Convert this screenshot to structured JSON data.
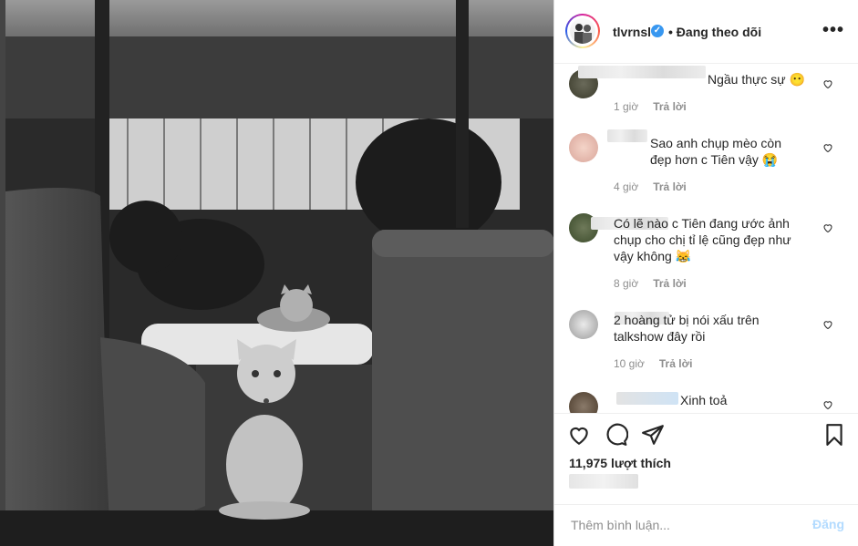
{
  "post": {
    "username": "tlvrnsl",
    "verified_icon": "verified-badge-icon",
    "follow_status": "• Đang theo dõi",
    "more_icon": "•••"
  },
  "comments": [
    {
      "text": "Ngầu thực sự 😶",
      "time": "1 giờ",
      "reply": "Trả lời"
    },
    {
      "text": "Sao anh chụp mèo còn đẹp hơn c Tiên vậy 😭",
      "time": "4 giờ",
      "reply": "Trả lời"
    },
    {
      "text": "Có lẽ nào c Tiên đang ước ảnh chụp cho chị tỉ lệ cũng đẹp như vậy không 😹",
      "time": "8 giờ",
      "reply": "Trả lời"
    },
    {
      "text": "2 hoàng tử bị nói xấu trên talkshow đây rồi",
      "time": "10 giờ",
      "reply": "Trả lời"
    },
    {
      "text": "Xinh toả",
      "time": "",
      "reply": ""
    }
  ],
  "actions": {
    "likes": "11,975 lượt thích"
  },
  "add_comment": {
    "placeholder": "Thêm bình luận...",
    "post_label": "Đăng"
  },
  "colors": {
    "accent": "#3897f0",
    "post_disabled": "#b3dbff",
    "meta": "#8e8e8e"
  }
}
